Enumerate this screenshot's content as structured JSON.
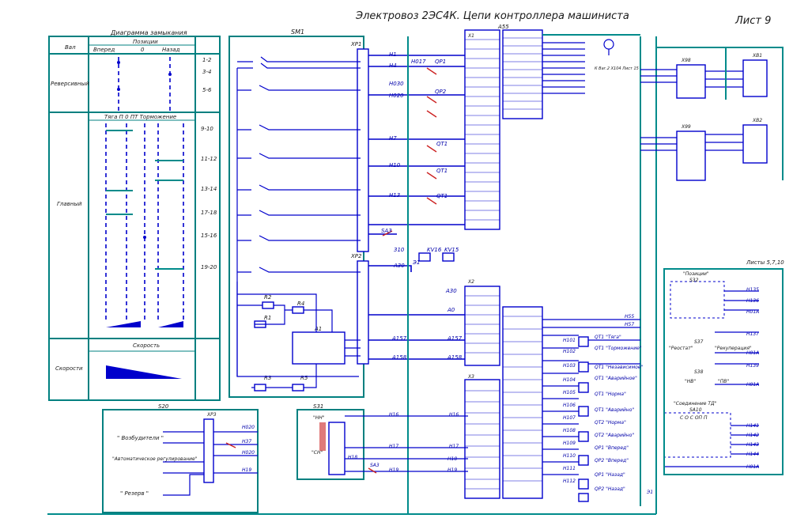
{
  "title": "Электровоз 2ЭС4К. Цепи контроллера машиниста",
  "sheet": "Лист 9",
  "diagram": {
    "header": "Диаграмма замыкания",
    "col_shaft": "Вал",
    "col_positions": "Позиции",
    "pos_forward": "Вперед",
    "pos_zero": "0",
    "pos_back": "Назад",
    "row_reverse": "Реверсивный",
    "row_main": "Главный",
    "row_speed": "Скорости",
    "main_labels": "Тяга    П    0    ПТ Торможение",
    "speed_header": "Скорость",
    "pairs": [
      "1-2",
      "3-4",
      "5-6",
      "9-10",
      "11-12",
      "13-14",
      "17-18",
      "15-16",
      "19-20"
    ]
  },
  "sm1": "SM1",
  "xp1": "XP1",
  "xp2": "XP2",
  "xp3": "XP3",
  "a55": "A55",
  "s20": "S20",
  "s31": "S31",
  "a1": "A1",
  "r_labels": [
    "R2",
    "R1",
    "R4",
    "R3",
    "R5"
  ],
  "wire_labels": [
    "Н1",
    "Н4",
    "Н2",
    "Н5",
    "Н6",
    "Н7",
    "Н8",
    "Н9",
    "Н10",
    "Н11",
    "Н12",
    "Н13",
    "Н15",
    "Н16",
    "Н17",
    "Н18",
    "Н19"
  ],
  "wire_labels2": [
    "Н017",
    "Н030",
    "Н020",
    "Н010",
    "А30",
    "А0",
    "А157",
    "А158",
    "Э1",
    "310"
  ],
  "qp_labels": [
    "QP1",
    "QP2",
    "QT1",
    "QT1",
    "QT1"
  ],
  "kv": [
    "KV16",
    "KV15"
  ],
  "sa3": "SA3",
  "s20_items": [
    "\" Возбудители \"",
    "\"Автоматическое регулирование\"",
    "\" Резерв \""
  ],
  "s20_wires": [
    "Н020",
    "Н37",
    "Н020",
    "Н19"
  ],
  "s31_labels": [
    "\"НН\"",
    "\"СН\""
  ],
  "a57_label": "A57",
  "x1_label": "X1",
  "x2_label": "X2",
  "x3_label": "X3",
  "right_top": {
    "x98": "X98",
    "x99": "X99",
    "xb1": "XB1",
    "xb2": "XB2",
    "ref": "К Ваг.2 X104 Лист 15"
  },
  "positions_box": {
    "title": "\"Позиции\"",
    "s32": "S32",
    "wires": [
      "Н135",
      "Н136",
      "Н01А"
    ]
  },
  "sheet_ref": "Листы 5,7,10",
  "s37": {
    "name": "S37",
    "a": "\"Реостат\"",
    "b": "\"Рекуперация\"",
    "wires": [
      "Н137",
      "Н01А"
    ]
  },
  "s38": {
    "name": "S38",
    "a": "\"НВ\"",
    "b": "\"ПВ\"",
    "wires": [
      "Н139",
      "Н01А"
    ]
  },
  "td_box": {
    "title": "\"Соединение ТД\"",
    "sa": "SA10",
    "cols": "С   О   С   ОП   П",
    "wires": [
      "Н141",
      "Н142",
      "Н143",
      "Н144",
      "Н01А"
    ]
  },
  "relays": [
    {
      "n": "Н101",
      "t": "QT1 \"Тяга\""
    },
    {
      "n": "Н102",
      "t": "QT1 \"Торможение\""
    },
    {
      "n": "Н103",
      "t": "QT1 \"Независимое\""
    },
    {
      "n": "Н104",
      "t": "QT1 \"Аварийное\""
    },
    {
      "n": "Н105",
      "t": "QT1 \"Норма\""
    },
    {
      "n": "Н106",
      "t": "QT1 \"Аварийно\""
    },
    {
      "n": "Н107",
      "t": "QT2 \"Норма\""
    },
    {
      "n": "Н108",
      "t": "QT2 \"Аварийно\""
    },
    {
      "n": "Н109",
      "t": "QP1 \"Вперед\""
    },
    {
      "n": "Н110",
      "t": "QP2 \"Вперед\""
    },
    {
      "n": "Н111",
      "t": "QP1 \"Назад\""
    },
    {
      "n": "Н112",
      "t": "QP2 \"Назад\""
    }
  ],
  "h_labels": [
    "Н55",
    "Н57"
  ],
  "e1": "Э1"
}
